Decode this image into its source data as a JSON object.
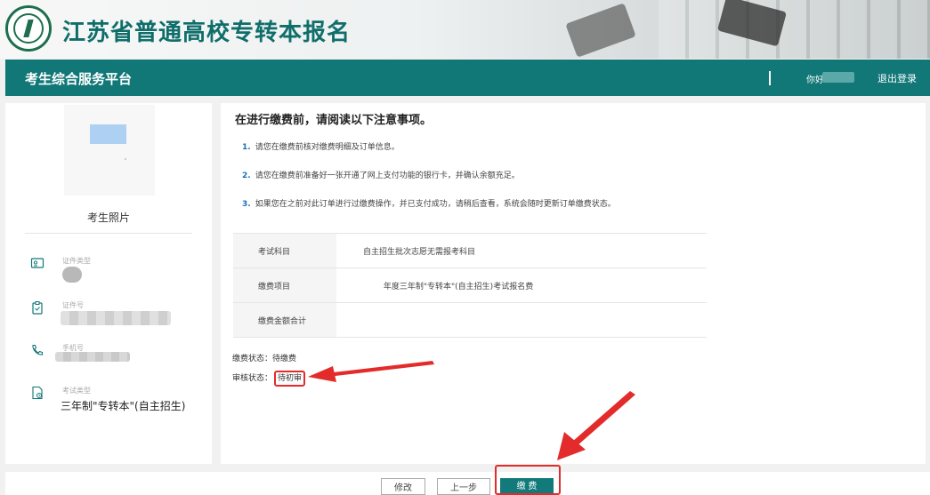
{
  "header": {
    "site_title": "江苏省普通高校专转本报名",
    "platform_title": "考生综合服务平台",
    "greeting": "你好",
    "logout": "退出登录"
  },
  "sidebar": {
    "photo_label": "考生照片",
    "fields": [
      {
        "label": "证件类型",
        "value": ""
      },
      {
        "label": "证件号",
        "value": ""
      },
      {
        "label": "手机号",
        "value": ""
      },
      {
        "label": "考试类型",
        "value": "三年制\"专转本\"(自主招生)"
      }
    ]
  },
  "main": {
    "notice_title": "在进行缴费前，请阅读以下注意事项。",
    "notices": [
      {
        "num": "1.",
        "text": "请您在缴费前核对缴费明细及订单信息。"
      },
      {
        "num": "2.",
        "text": "请您在缴费前准备好一张开通了网上支付功能的银行卡，并确认余额充足。"
      },
      {
        "num": "3.",
        "text": "如果您在之前对此订单进行过缴费操作，并已支付成功，请稍后查看，系统会随时更新订单缴费状态。"
      }
    ],
    "fee_table": [
      {
        "key": "考试科目",
        "value": "自主招生批次志愿无需报考科目"
      },
      {
        "key": "缴费项目",
        "value": "        年度三年制\"专转本\"(自主招生)考试报名费"
      },
      {
        "key": "缴费金额合计",
        "value": ""
      }
    ],
    "pay_status_label": "缴费状态：",
    "pay_status_value": "待缴费",
    "review_status_label": "审核状态：",
    "review_status_value": "待初审"
  },
  "footer": {
    "modify": "修改",
    "prev": "上一步",
    "pay": "缴 费"
  },
  "colors": {
    "primary": "#117777",
    "highlight": "#e32b2b",
    "link_number": "#1b6fbe"
  }
}
